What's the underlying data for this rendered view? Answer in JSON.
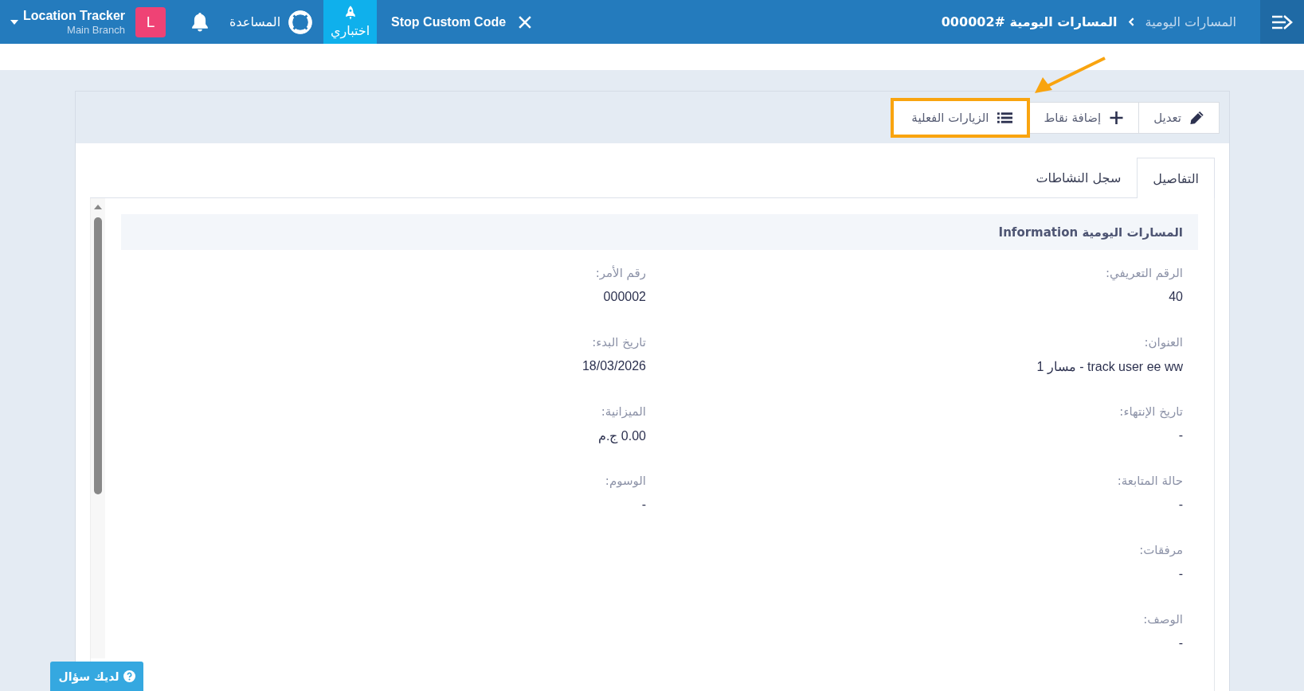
{
  "top_bar": {
    "app": {
      "title": "Location Tracker",
      "subtitle": "Main Branch"
    },
    "avatar": "L",
    "help": "المساعدة",
    "test_tab": {
      "label": "اختباري",
      "selected": true
    },
    "custom_code": "Stop Custom Code",
    "breadcrumb": [
      "المسارات اليومية",
      "المسارات اليومية #000002"
    ]
  },
  "toolbar": {
    "buttons": [
      {
        "kind": "edit",
        "label": "تعديل",
        "highlighted": false
      },
      {
        "kind": "add",
        "label": "إضافة نقاط",
        "highlighted": false
      },
      {
        "kind": "list",
        "label": "الزيارات الفعلية",
        "highlighted": true
      }
    ]
  },
  "tabs": [
    {
      "label": "التفاصيل",
      "selected": true
    },
    {
      "label": "سجل النشاطات",
      "selected": false
    }
  ],
  "section_title": "المسارات اليومية Information",
  "field_rows": [
    [
      {
        "label": "الرقم التعريفي:",
        "value": "40"
      },
      {
        "label": "رقم الأمر:",
        "value": "000002"
      }
    ],
    [
      {
        "label": "العنوان:",
        "value": "track user ee ww - مسار 1"
      },
      {
        "label": "تاريخ البدء:",
        "value": "18/03/2026"
      }
    ],
    [
      {
        "label": "تاريخ الإنتهاء:",
        "value": "-"
      },
      {
        "label": "الميزانية:",
        "value": "0.00 ج.م"
      }
    ],
    [
      {
        "label": "حالة المتابعة:",
        "value": "-"
      },
      {
        "label": "الوسوم:",
        "value": "-"
      }
    ],
    [
      {
        "label": "مرفقات:",
        "value": "-"
      }
    ],
    [
      {
        "label": "الوصف:",
        "value": "-"
      }
    ]
  ],
  "help_button": "لديك سؤال"
}
